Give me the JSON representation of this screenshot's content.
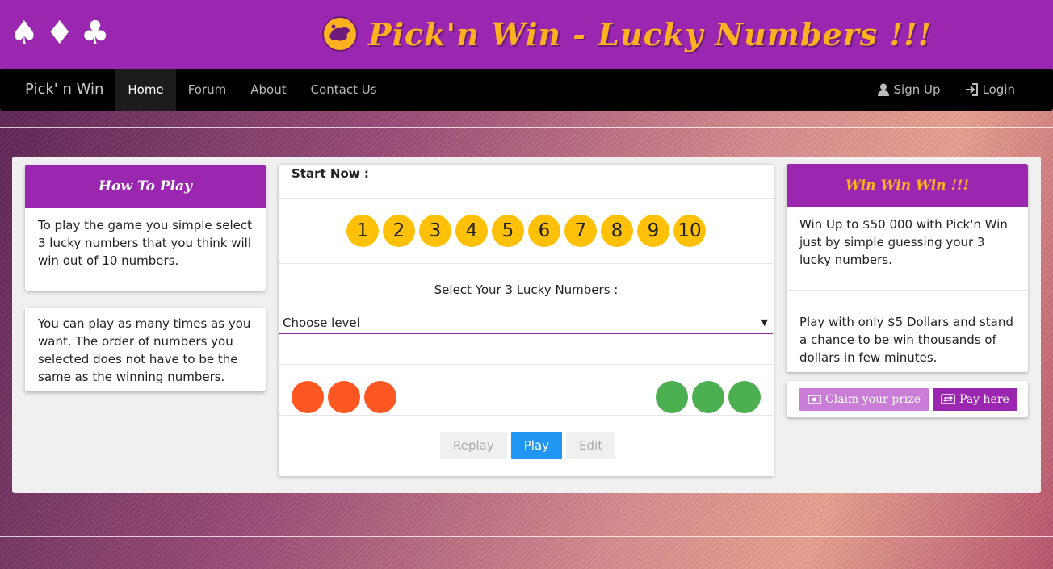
{
  "banner": {
    "suits": [
      "♠",
      "♦",
      "♣"
    ],
    "title": "Pick'n Win - Lucky Numbers !!!"
  },
  "nav": {
    "brand": "Pick' n Win",
    "items": [
      "Home",
      "Forum",
      "About",
      "Contact Us"
    ],
    "active": "Home",
    "signup": "Sign Up",
    "login": "Login"
  },
  "how_to_play": {
    "title": "How To Play",
    "text1": "To play the game you simple select 3 lucky numbers that you think will win out of 10 numbers.",
    "text2": "You can play as many times as you want. The order of numbers you selected does not have to be the same as the winning numbers."
  },
  "game": {
    "start_label": "Start Now :",
    "numbers": [
      "1",
      "2",
      "3",
      "4",
      "5",
      "6",
      "7",
      "8",
      "9",
      "10"
    ],
    "select_label": "Select Your 3 Lucky Numbers :",
    "level_placeholder": "Choose level",
    "buttons": {
      "replay": "Replay",
      "play": "Play",
      "edit": "Edit"
    }
  },
  "win": {
    "title": "Win Win Win !!!",
    "text1": "Win Up to $50 000 with Pick'n Win just by simple guessing your 3 lucky numbers.",
    "text2": "Play with only $5 Dollars and stand a chance to be win thousands of dollars in few minutes.",
    "claim": "Claim your prize",
    "pay": "Pay here"
  },
  "colors": {
    "brand_purple": "#9b27b0",
    "title_orange": "#ffb11f",
    "ball_yellow": "#ffc107",
    "orange_dot": "#ff5722",
    "green_dot": "#4caf50",
    "play_blue": "#2196f3"
  }
}
